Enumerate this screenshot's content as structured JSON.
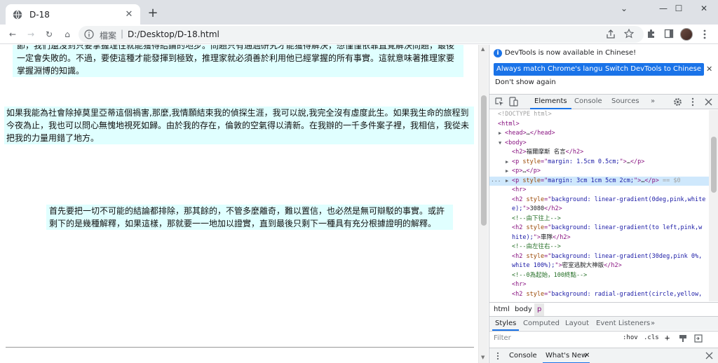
{
  "tab": {
    "title": "D-18",
    "close": "✕"
  },
  "newtab": "+",
  "window_controls": {
    "minimize": "—",
    "maximize": "☐",
    "close": "✕",
    "chevron": "⌄"
  },
  "toolbar": {
    "back": "←",
    "forward": "→",
    "reload": "↻",
    "home": "⌂"
  },
  "omnibox": {
    "label": "檔案",
    "separator": "|",
    "url": "D:/Desktop/D-18.html"
  },
  "page": {
    "p1": "節，我們還沒到只要掌握理性就能獲得結論的地步。問題只有通過研究才能獲得解決，想僅僅依靠直覺解決問題，最後一定會失敗的。不過，要使這種才能發揮到極致，推理家就必須善於利用他已經掌握的所有事實。這就意味著推理家要掌握淵博的知識。",
    "p2": "如果我能為社會除掉莫里亞蒂這個禍害,那麼,我情願結束我的偵探生涯，我可以說,我完全沒有虛度此生。如果我生命的旅程到今夜為止，我也可以問心無愧地視死如歸。由於我的存在，倫敦的空氣得以清新。在我辦的一千多件案子裡，我相信，我從未把我的力量用錯了地方。",
    "p3": "首先要把一切不可能的結論都排除，那其餘的，不管多麼離奇，難以置信，也必然是無可辯駁的事實。或許剩下的是幾種解釋，如果這樣，那就要一一地加以證實，直到最後只剩下一種具有充分根據證明的解釋。"
  },
  "devtools": {
    "banner": {
      "message": "DevTools is now available in Chinese!",
      "btn_match": "Always match Chrome's language",
      "btn_switch": "Switch DevTools to Chinese",
      "btn_dont": "Don't show again",
      "close": "✕"
    },
    "tabs": [
      "Elements",
      "Console",
      "Sources"
    ],
    "more": "»",
    "dom": [
      {
        "indent": 0,
        "html": "<span class='dim'>&lt;!DOCTYPE html&gt;</span>"
      },
      {
        "indent": 0,
        "html": "<span class='tag'>&lt;html&gt;</span>"
      },
      {
        "indent": 1,
        "tri": "▶",
        "html": "<span class='tag'>&lt;head&gt;</span><span class='txt'>…</span><span class='tag'>&lt;/head&gt;</span>"
      },
      {
        "indent": 1,
        "tri": "▼",
        "html": "<span class='tag'>&lt;body&gt;</span>"
      },
      {
        "indent": 2,
        "html": "<span class='tag'>&lt;h2&gt;</span><span class='txt'>福爾摩斯 名言</span><span class='tag'>&lt;/h2&gt;</span>"
      },
      {
        "indent": 2,
        "tri": "▶",
        "html": "<span class='tag'>&lt;p </span><span class='attr'>style</span><span class='tag'>=\"</span><span class='val'>margin: 1.5cm 0.5cm;</span><span class='tag'>\"&gt;</span><span class='txt'>…</span><span class='tag'>&lt;/p&gt;</span>"
      },
      {
        "indent": 2,
        "tri": "▶",
        "html": "<span class='tag'>&lt;p&gt;</span><span class='txt'>…</span><span class='tag'>&lt;/p&gt;</span>"
      },
      {
        "indent": 2,
        "tri": "▶",
        "sel": true,
        "html": "<span class='tag'>&lt;p </span><span class='attr'>style</span><span class='tag'>=\"</span><span class='val'>margin: 3cm 1cm 5cm 2cm;</span><span class='tag'>\"&gt;</span><span class='txt'>…</span><span class='tag'>&lt;/p&gt;</span><span class='dim'> == $0</span>"
      },
      {
        "indent": 2,
        "html": "<span class='tag'>&lt;hr&gt;</span>"
      },
      {
        "indent": 2,
        "html": "<span class='tag'>&lt;h2 </span><span class='attr'>style</span><span class='tag'>=\"</span><span class='val'>background: linear-gradient(0deg,pink,white</span>"
      },
      {
        "indent": 2,
        "html": "<span class='val'>e);</span><span class='tag'>\"&gt;</span><span class='txt'>3080</span><span class='tag'>&lt;/h2&gt;</span>"
      },
      {
        "indent": 2,
        "html": "<span class='cmt'>&lt;!--由下往上--&gt;</span>"
      },
      {
        "indent": 2,
        "html": "<span class='tag'>&lt;h2 </span><span class='attr'>style</span><span class='tag'>=\"</span><span class='val'>background: linear-gradient(to left,pink,w</span>"
      },
      {
        "indent": 2,
        "html": "<span class='val'>hite);</span><span class='tag'>\"&gt;</span><span class='txt'>車隊</span><span class='tag'>&lt;/h2&gt;</span>"
      },
      {
        "indent": 2,
        "html": "<span class='cmt'>&lt;!--由左往右--&gt;</span>"
      },
      {
        "indent": 2,
        "html": "<span class='tag'>&lt;h2 </span><span class='attr'>style</span><span class='tag'>=\"</span><span class='val'>background: linear-gradient(30deg,pink 0%,</span>"
      },
      {
        "indent": 2,
        "html": "<span class='val'>white 100%);</span><span class='tag'>\"&gt;</span><span class='txt'>密室逃脫大神版</span><span class='tag'>&lt;/h2&gt;</span>"
      },
      {
        "indent": 2,
        "html": "<span class='cmt'>&lt;!--0為起始，100終點--&gt;</span>"
      },
      {
        "indent": 2,
        "html": "<span class='tag'>&lt;hr&gt;</span>"
      },
      {
        "indent": 2,
        "html": "<span class='tag'>&lt;h2 </span><span class='attr'>style</span><span class='tag'>=\"</span><span class='val'>background: radial-gradient(circle,yellow,</span>"
      }
    ],
    "crumbs": [
      "html",
      "body",
      "p"
    ],
    "style_tabs": [
      "Styles",
      "Computed",
      "Layout",
      "Event Listeners"
    ],
    "filter": {
      "placeholder": "Filter",
      "hov": ":hov",
      "cls": ".cls",
      "plus": "+"
    },
    "drawer": {
      "console": "Console",
      "whatsnew": "What's New",
      "close": "✕"
    }
  }
}
